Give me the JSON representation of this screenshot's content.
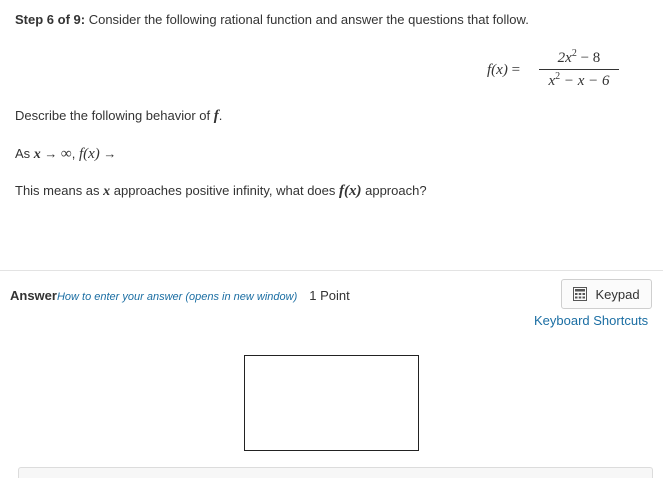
{
  "step": {
    "label": "Step 6 of 9:",
    "instruction": "Consider the following rational function and answer the questions that follow."
  },
  "formula": {
    "lhs": "f(x)",
    "equals": "=",
    "numerator_base": "2x",
    "numerator_exp": "2",
    "numerator_rest": " − 8",
    "denominator_base": "x",
    "denominator_exp": "2",
    "denominator_rest": " − x − 6"
  },
  "question": {
    "describe_prefix": "Describe the following behavior of ",
    "describe_var": "f",
    "describe_suffix": ".",
    "limit_prefix": "As ",
    "limit_var": "x",
    "limit_arrow": " → ",
    "limit_inf": "∞",
    "limit_comma": ", ",
    "limit_func": "f(x)",
    "limit_arrow2": " →",
    "means_prefix": "This means as ",
    "means_var": "x",
    "means_mid": " approaches positive infinity, what does ",
    "means_func": "f(x)",
    "means_suffix": " approach?"
  },
  "answer": {
    "label": "Answer",
    "howto_link": "How to enter your answer (opens in new window)",
    "points": "1 Point",
    "value": ""
  },
  "tools": {
    "keypad_label": "Keypad",
    "shortcuts_label": "Keyboard Shortcuts"
  },
  "colors": {
    "link": "#1b6ea3",
    "text": "#333333"
  }
}
